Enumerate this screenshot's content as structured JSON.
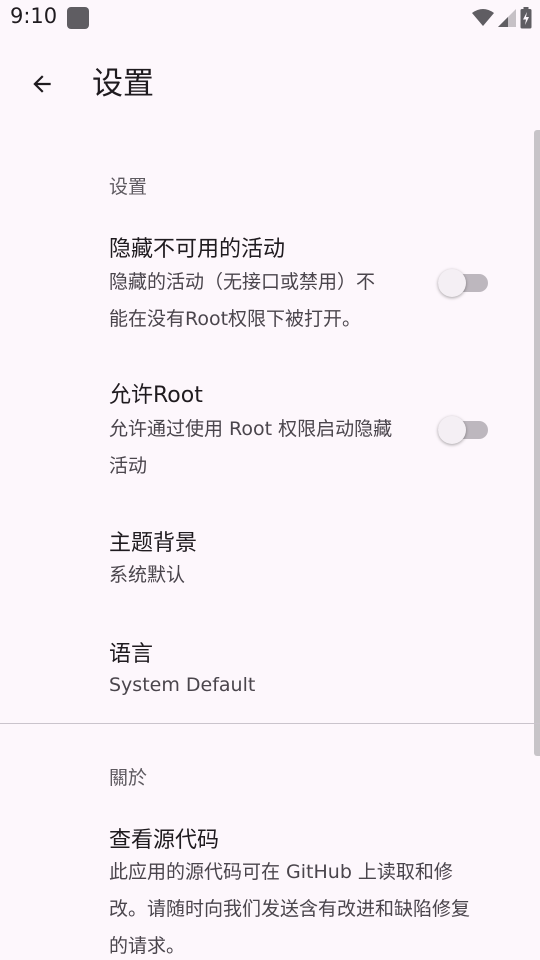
{
  "status_bar": {
    "time": "9:10",
    "icons": [
      "notification-icon",
      "wifi-icon",
      "signal-icon",
      "battery-charging-icon"
    ]
  },
  "app_bar": {
    "title": "设置"
  },
  "sections": {
    "settings": {
      "header": "设置",
      "hide_unavailable": {
        "title": "隐藏不可用的活动",
        "summary_line1": "隐藏的活动（无接口或禁用）不",
        "summary_line2": "能在没有Root权限下被打开。",
        "enabled": false
      },
      "allow_root": {
        "title": "允许Root",
        "summary_line1": "允许通过使用 Root 权限启动隐藏",
        "summary_line2": "活动",
        "enabled": false
      },
      "theme": {
        "title": "主题背景",
        "value": "系统默认"
      },
      "language": {
        "title": "语言",
        "value": "System Default"
      }
    },
    "about": {
      "header": "關於",
      "source_code": {
        "title": "查看源代码",
        "summary_line1": "此应用的源代码可在 GitHub 上读取和修",
        "summary_line2": "改。请随时向我们发送含有改进和缺陷修复",
        "summary_line3": "的请求。"
      }
    }
  },
  "colors": {
    "background": "#FDF7FC",
    "text_primary": "#1F1B1F",
    "text_secondary": "#4A454C",
    "switch_track_off": "#BDB7BE",
    "switch_thumb_off": "#F4EFF4"
  }
}
